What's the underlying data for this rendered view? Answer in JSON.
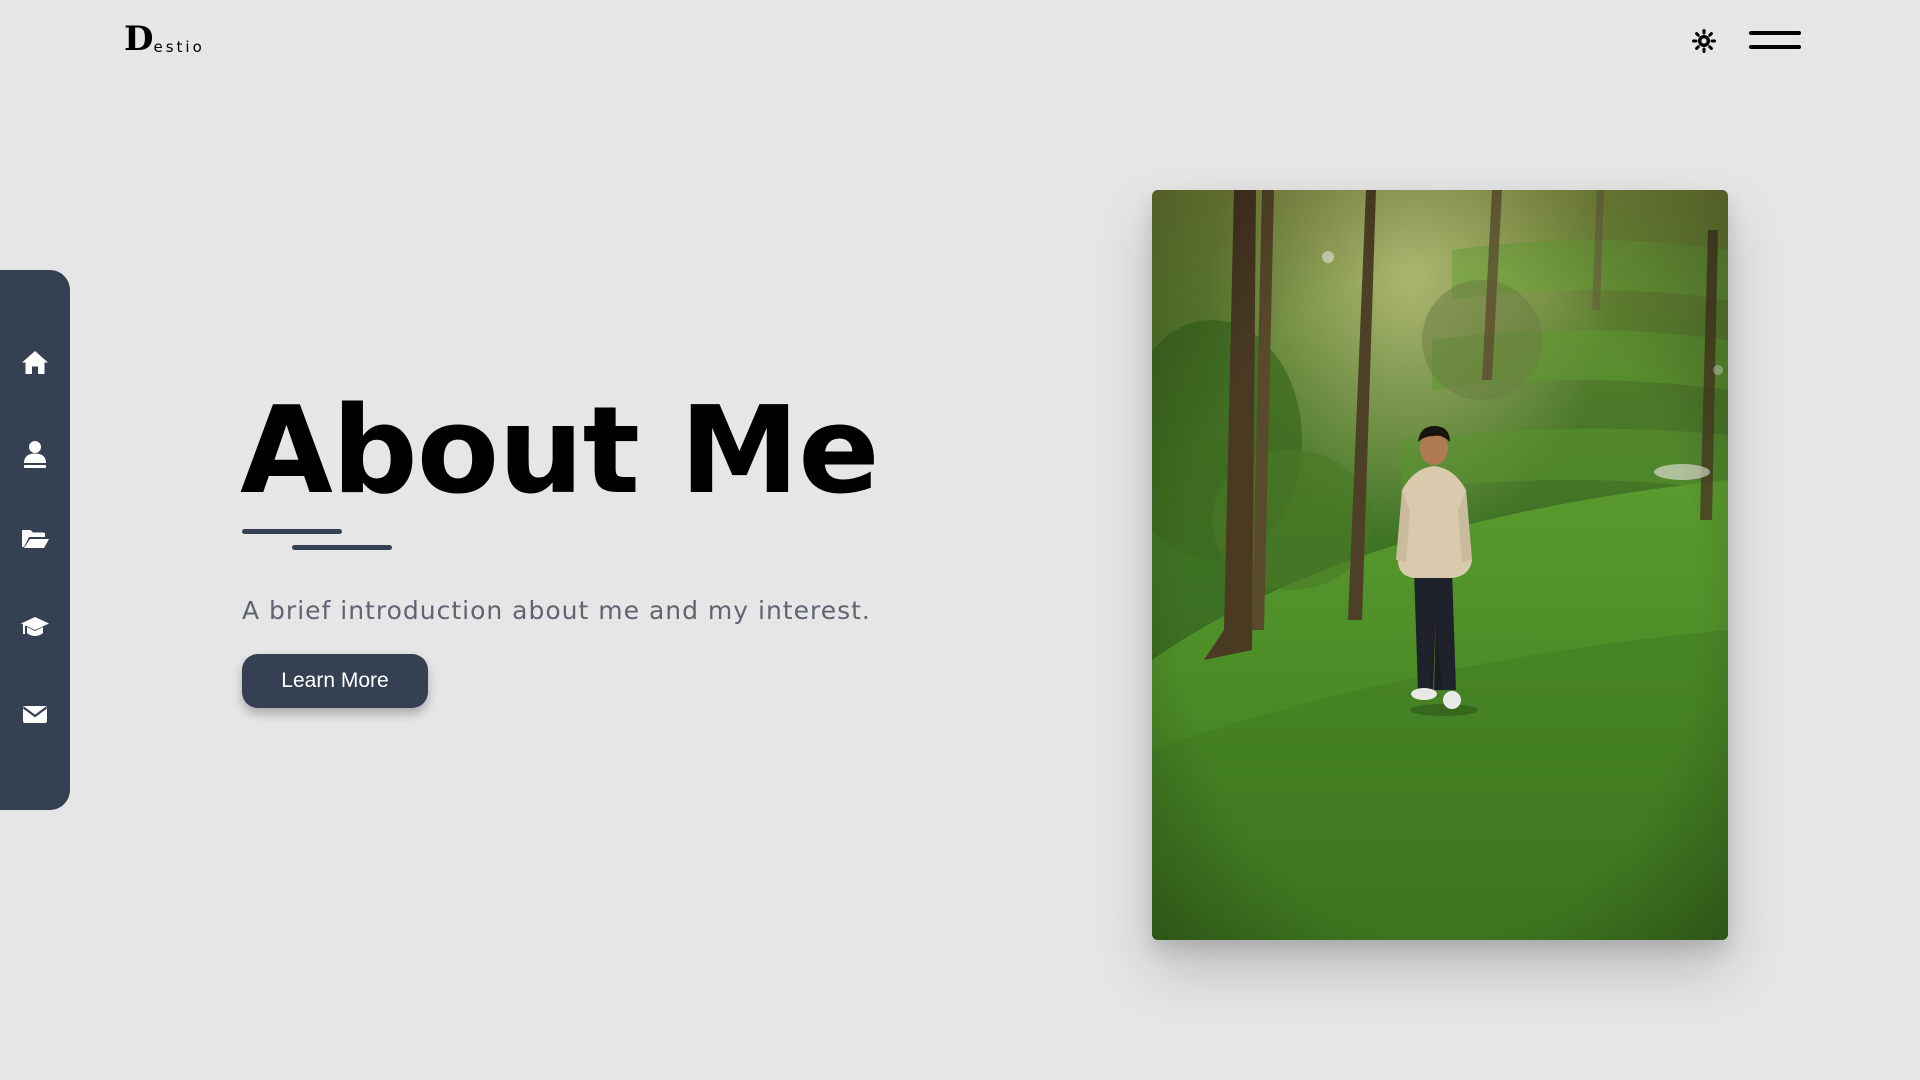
{
  "header": {
    "logo": {
      "initial": "D",
      "rest": "estio"
    },
    "theme_toggle_icon": "sun-icon",
    "menu_icon": "hamburger-menu-icon"
  },
  "sidebar": {
    "items": [
      {
        "icon": "home-icon"
      },
      {
        "icon": "user-icon"
      },
      {
        "icon": "folder-open-icon"
      },
      {
        "icon": "graduation-cap-icon"
      },
      {
        "icon": "envelope-icon"
      }
    ],
    "background": "#354053"
  },
  "hero": {
    "title": "About Me",
    "subtitle": "A brief introduction about me and my interest.",
    "cta_label": "Learn More"
  },
  "colors": {
    "page_background": "#e6e6e7",
    "accent": "#354053",
    "subtitle": "#5f6470"
  }
}
